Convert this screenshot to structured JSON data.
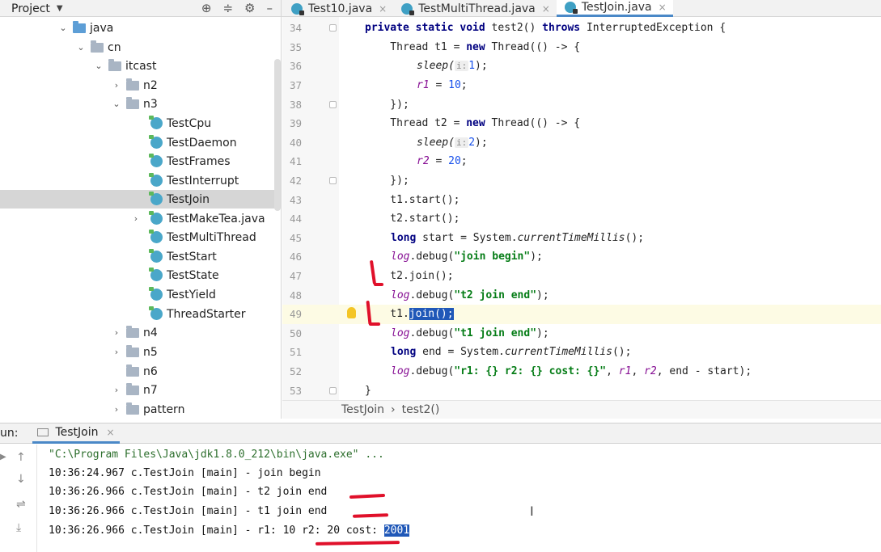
{
  "project_panel": {
    "title": "Project"
  },
  "tabs": [
    {
      "label": "Test10.java",
      "close": "×"
    },
    {
      "label": "TestMultiThread.java",
      "close": "×"
    },
    {
      "label": "TestJoin.java",
      "close": "×"
    }
  ],
  "tree": {
    "java": "java",
    "cn": "cn",
    "itcast": "itcast",
    "n2": "n2",
    "n3": "n3",
    "classes": [
      "TestCpu",
      "TestDaemon",
      "TestFrames",
      "TestInterrupt",
      "TestJoin",
      "TestMakeTea.java",
      "TestMultiThread",
      "TestStart",
      "TestState",
      "TestYield",
      "ThreadStarter"
    ],
    "after": [
      "n4",
      "n5",
      "n6",
      "n7",
      "pattern"
    ]
  },
  "line_numbers": [
    "34",
    "35",
    "36",
    "37",
    "38",
    "39",
    "40",
    "41",
    "42",
    "43",
    "44",
    "45",
    "46",
    "47",
    "48",
    "49",
    "50",
    "51",
    "52",
    "53"
  ],
  "code": {
    "l34_kw": "private static void",
    "l34_a": " test2() ",
    "l34_kw2": "throws",
    "l34_b": " InterruptedException {",
    "l35_a": "    Thread t1 = ",
    "l35_kw": "new",
    "l35_b": " Thread(() -> {",
    "l36_a": "sleep(",
    "l36_hint": "i:",
    "l36_n": "1",
    "l36_b": ");",
    "l37_a": "r1",
    "l37_b": " = ",
    "l37_n": "10",
    "l37_c": ";",
    "l38": "    });",
    "l39_a": "    Thread t2 = ",
    "l39_kw": "new",
    "l39_b": " Thread(() -> {",
    "l40_a": "sleep(",
    "l40_hint": "i:",
    "l40_n": "2",
    "l40_b": ");",
    "l41_a": "r2",
    "l41_b": " = ",
    "l41_n": "20",
    "l41_c": ";",
    "l42": "    });",
    "l43": "    t1.start();",
    "l44": "    t2.start();",
    "l45_kw": "long",
    "l45_a": " start = System.",
    "l45_m": "currentTimeMillis",
    "l45_b": "();",
    "l46_log": "log",
    "l46_a": ".debug(",
    "l46_s": "\"join begin\"",
    "l46_b": ");",
    "l47": "    t2.join();",
    "l48_log": "log",
    "l48_a": ".debug(",
    "l48_s": "\"t2 join end\"",
    "l48_b": ");",
    "l49_a": "    t1.",
    "l49_sel": "join();",
    "l50_log": "log",
    "l50_a": ".debug(",
    "l50_s": "\"t1 join end\"",
    "l50_b": ");",
    "l51_kw": "long",
    "l51_a": " end = System.",
    "l51_m": "currentTimeMillis",
    "l51_b": "();",
    "l52_log": "log",
    "l52_a": ".debug(",
    "l52_s": "\"r1: {} r2: {} cost: {}\"",
    "l52_b": ", ",
    "l52_r1": "r1",
    "l52_c": ", ",
    "l52_r2": "r2",
    "l52_d": ", end - start);",
    "l53": "}"
  },
  "breadcrumb": {
    "class": "TestJoin",
    "sep": "›",
    "method": "test2()"
  },
  "run": {
    "label": "un:",
    "tab": "TestJoin",
    "close": "×"
  },
  "console": {
    "line0": "\"C:\\Program Files\\Java\\jdk1.8.0_212\\bin\\java.exe\" ...",
    "line1": "10:36:24.967 c.TestJoin [main] - join begin",
    "line2": "10:36:26.966 c.TestJoin [main] - t2 join end",
    "line3": "10:36:26.966 c.TestJoin [main] - t1 join end",
    "line4_a": "10:36:26.966 c.TestJoin [main] - r1: 10 r2: 20 cost: ",
    "line4_sel": "2001"
  },
  "colors": {
    "keyword": "#000080",
    "string": "#067d17",
    "field": "#871094",
    "number": "#1750eb",
    "selection": "#2058b8",
    "annotation": "#e0102a"
  }
}
